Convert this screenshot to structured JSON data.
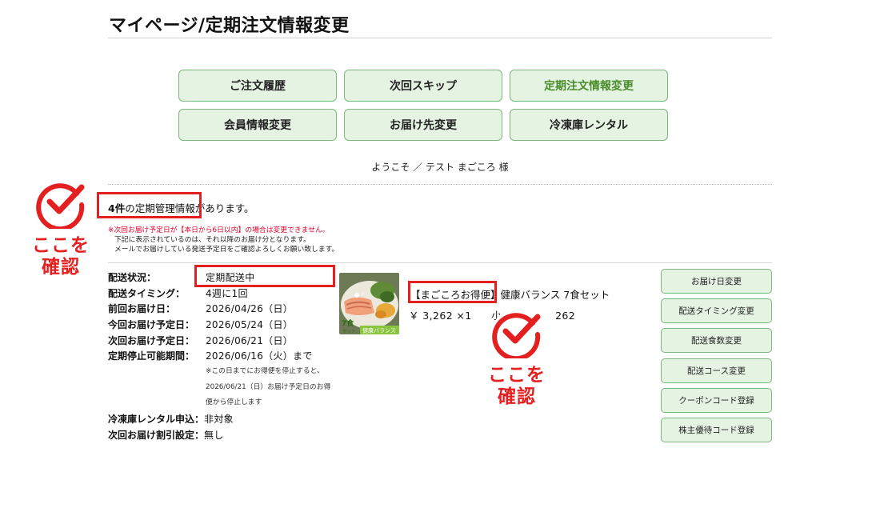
{
  "page": {
    "title": "マイページ/定期注文情報変更"
  },
  "nav": [
    {
      "label": "ご注文履歴"
    },
    {
      "label": "次回スキップ"
    },
    {
      "label": "定期注文情報変更"
    },
    {
      "label": "会員情報変更"
    },
    {
      "label": "お届け先変更"
    },
    {
      "label": "冷凍庫レンタル"
    }
  ],
  "welcome": "ようこそ ／ テスト まごころ 様",
  "summary": {
    "count": "4件",
    "text": "の定期管理情報があります。"
  },
  "notice": {
    "warning": "※次回お届け予定日が【本日から6日以内】の場合は変更できません。",
    "line2": "下記に表示されているのは、それ以降のお届け分となります。",
    "line3": "メールでお届けしている発送予定日をご確認よろしくお願い致します。"
  },
  "details": {
    "status": {
      "label": "配送状況：",
      "value": "定期配送中"
    },
    "timing": {
      "label": "配送タイミング：",
      "value": "4週に1回"
    },
    "previous": {
      "label": "前回お届け日：",
      "value": "2026/04/26（日）"
    },
    "current": {
      "label": "今回お届け予定日：",
      "value": "2026/05/24（日）"
    },
    "next": {
      "label": "次回お届け予定日：",
      "value": "2026/06/21（日）"
    },
    "stop": {
      "label": "定期停止可能期間：",
      "value": "2026/06/16（火）まで"
    },
    "stop_note": "※この日までにお得便を停止すると、2026/06/21（日）お届け予定日のお得便から停止します",
    "freezer": {
      "label": "冷凍庫レンタル申込：",
      "value": "非対象"
    },
    "discount": {
      "label": "次回お届け割引設定：",
      "value": "無し"
    }
  },
  "product": {
    "badge": "【まごころお得便】",
    "name": "健康バランス 7食セット",
    "price": "￥ 3,262 ×1",
    "subtotal_label": "小",
    "subtotal": "262",
    "image_label": "7食",
    "image_sub": "セット",
    "image_banner": "健康バランス"
  },
  "actions": [
    {
      "label": "お届け日変更"
    },
    {
      "label": "配送タイミング変更"
    },
    {
      "label": "配送食数変更"
    },
    {
      "label": "配送コース変更"
    },
    {
      "label": "クーポンコード登録"
    },
    {
      "label": "株主優待コード登録"
    }
  ],
  "annotation": {
    "line1": "ここを",
    "line2": "確認"
  },
  "colors": {
    "highlight": "#e41f1f",
    "button_bg": "#e5f3e2",
    "button_border": "#7cb87c",
    "active_text": "#4a8c2a",
    "warning_text": "#e0002a"
  }
}
